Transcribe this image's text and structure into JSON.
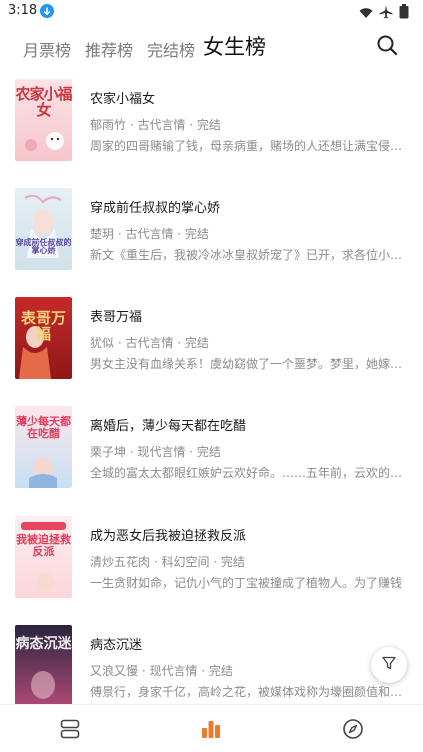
{
  "status_bar": {
    "time": "3:18",
    "icons": [
      "download-icon",
      "wifi-icon",
      "airplane-icon",
      "battery-icon"
    ]
  },
  "tabs": [
    {
      "label": "月票榜",
      "active": false
    },
    {
      "label": "推荐榜",
      "active": false
    },
    {
      "label": "完结榜",
      "active": false
    },
    {
      "label": "女生榜",
      "active": true
    }
  ],
  "search_icon": "search-icon",
  "books": [
    {
      "title": "农家小福女",
      "author": "郁雨竹",
      "genre": "古代言情",
      "status": "完结",
      "meta": "郁雨竹 · 古代言情 · 完结",
      "description": "周家的四哥赌输了钱，母亲病重，赌场的人还想让满宝侵占家产，偏偏她什么都没有，但是她有科科",
      "cover_text": "农家小福女"
    },
    {
      "title": "穿成前任叔叔的掌心娇",
      "author": "楚玥",
      "genre": "古代言情",
      "status": "完结",
      "meta": "楚玥 · 古代言情 · 完结",
      "description": "新文《重生后，我被冷冰冰皇叔娇宠了》已开，求各位小可爱收藏",
      "cover_text": "穿成前任叔叔的掌心娇"
    },
    {
      "title": "表哥万福",
      "author": "犹似",
      "genre": "古代言情",
      "status": "完结",
      "meta": "犹似 · 古代言情 · 完结",
      "description": "男女主没有血缘关系！虞幼窈做了一个噩梦。梦里，她嫁给了表哥",
      "cover_text": "表哥万福"
    },
    {
      "title": "离婚后，薄少每天都在吃醋",
      "author": "栗子坤",
      "genre": "现代言情",
      "status": "完结",
      "meta": "栗子坤 · 现代言情 · 完结",
      "description": "全城的富太太都眼红嫉妒云欢好命。……五年前，云欢的妹妹",
      "cover_text": "薄少每天都在吃醋"
    },
    {
      "title": "成为恶女后我被迫拯救反派",
      "author": "清炒五花肉",
      "genre": "科幻空间",
      "status": "完结",
      "meta": "清炒五花肉 · 科幻空间 · 完结",
      "description": "一生贪财如命，记仇小气的丁宝被撞成了植物人。为了赚钱",
      "cover_text": "我被迫拯救反派"
    },
    {
      "title": "病态沉迷",
      "author": "又浪又慢",
      "genre": "现代言情",
      "status": "完结",
      "meta": "又浪又慢 · 现代言情 · 完结",
      "description": "傅景行，身家千亿，高岭之花，被媒体戏称为壕圈颜值和人品",
      "cover_text": "病态沉迷"
    }
  ],
  "filter_icon": "filter-icon",
  "bottom_nav": [
    {
      "icon": "bookshelf-icon",
      "active": false
    },
    {
      "icon": "ranking-icon",
      "active": true
    },
    {
      "icon": "compass-icon",
      "active": false
    }
  ],
  "colors": {
    "accent": "#ee7a2c",
    "text_primary": "#1a1a1a",
    "text_secondary": "#8c8c8c",
    "tab_inactive": "#7a7a7a"
  }
}
